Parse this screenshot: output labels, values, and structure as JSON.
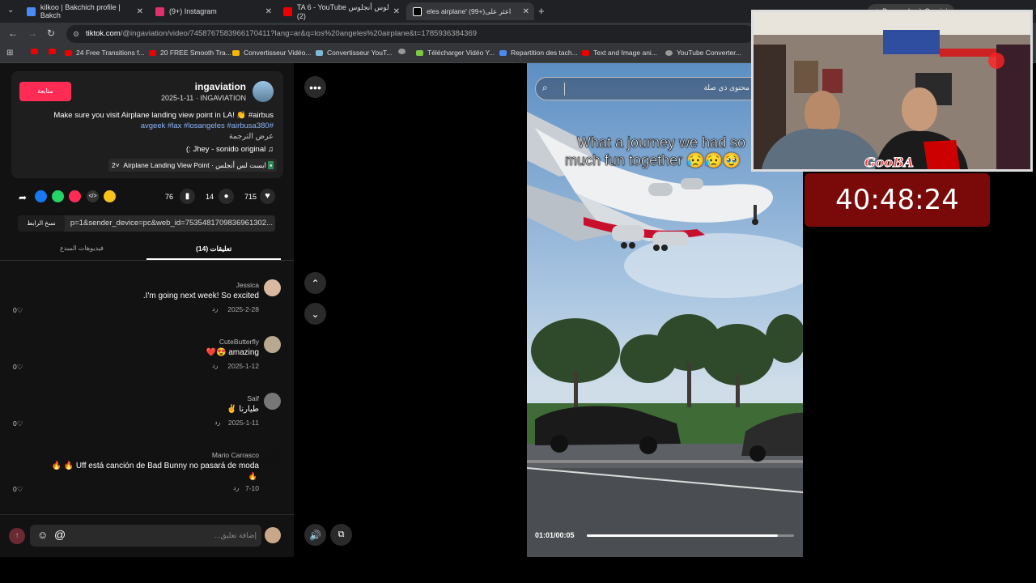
{
  "tabs": [
    {
      "title": "kilkoo | Bakchich profile | Bakch",
      "color": "#4a8af4"
    },
    {
      "title": "(9+) Instagram",
      "color": "#e1306c"
    },
    {
      "title": "TA 6 - YouTube لوس أنجلوس (2)",
      "color": "#e00"
    },
    {
      "title": "eles airplane' (99+)اعثر على",
      "color": "#fff"
    }
  ],
  "gemini_button": "Demander à Gemini",
  "url": {
    "domain": "tiktok.com",
    "path": "/@ingaviation/video/7458767583966170411?lang=ar&q=los%20angeles%20airplane&t=1785936384369"
  },
  "bookmarks": [
    "24 Free Transitions f...",
    "20 FREE Smooth Tra...",
    "Convertisseur Vidéo...",
    "Convertisseur YouT...",
    "",
    "Télécharger Vidéo Y...",
    "Repartition des tach...",
    "Text and Image ani...",
    "YouTube Converter..."
  ],
  "post": {
    "follow_label": "متابعة",
    "username": "ingaviation",
    "date_line": "2025-1-11 · INGAVIATION",
    "caption1": "Make sure you visit Airplane landing view point in LA! 👏 #airbus",
    "caption2": "#avgeek #lax #losangeles #airbusa380",
    "translate": "عرض الترجمة",
    "music": "♫ Jhey - sonido original :)",
    "location": "Airplane Landing View Point · ابست لس أنجلس",
    "location_count": "2",
    "likes": "715",
    "comments_count": "14",
    "saves": "76",
    "link_text": "p=1&sender_device=pc&web_id=7535481709836961302...",
    "copy_label": "نسخ الرابط"
  },
  "comment_tabs": {
    "comments": "تعليقات (14)",
    "creator_videos": "فيديوهات المبدع"
  },
  "comments": [
    {
      "name": "Jessica",
      "text": "I'm going next week! So excited.",
      "date": "2025-2-28",
      "reply": "رد",
      "likes": "0",
      "avatar": "#d9b9a0"
    },
    {
      "name": "CuteButterfly",
      "text": "amazing 😍❤️",
      "date": "2025-1-12",
      "reply": "رد",
      "likes": "0",
      "avatar": "#b8a890"
    },
    {
      "name": "Saif",
      "text": "طيارنا ✌️",
      "date": "2025-1-11",
      "reply": "رد",
      "likes": "0",
      "avatar": "#777"
    },
    {
      "name": "Mario Carrasco",
      "text": "Uff está canción de Bad Bunny no pasará de moda 🔥 🔥",
      "text2": "🔥",
      "date": "7-10",
      "reply": "رد",
      "likes": "0",
      "avatar": "#111"
    }
  ],
  "comment_input_placeholder": "إضافة تعليق...",
  "video": {
    "search_placeholder": "محتوى ذي صلة",
    "caption_line1": "What a journey we had so",
    "caption_line2": "much fun together 😥😥🥹",
    "time": "01:01/00:05",
    "progress": 0.92
  },
  "overlay": {
    "gooba": "GooBA",
    "timer": "40:48:24"
  }
}
